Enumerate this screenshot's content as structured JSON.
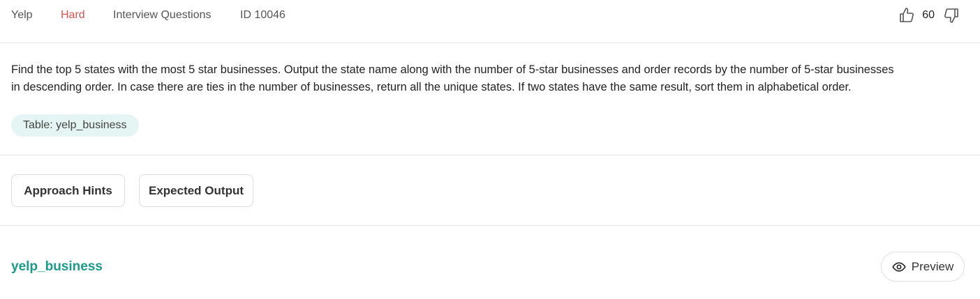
{
  "meta": {
    "company": "Yelp",
    "difficulty": "Hard",
    "category": "Interview Questions",
    "question_id": "ID 10046"
  },
  "votes": {
    "count": "60",
    "upvote_icon": "thumbs-up-icon",
    "downvote_icon": "thumbs-down-icon"
  },
  "question": {
    "line1": "Find the top 5 states with the most 5 star businesses. Output the state name along with the number of 5-star businesses and order records by the number of 5-star businesses",
    "line2": "in descending order. In case there are ties in the number of businesses, return all the unique states. If two states have the same result, sort them in alphabetical order.",
    "table_chip": "Table: yelp_business"
  },
  "actions": {
    "hints_label": "Approach Hints",
    "output_label": "Expected Output"
  },
  "table_section": {
    "table_name": "yelp_business",
    "preview_label": "Preview",
    "preview_icon": "eye-icon"
  },
  "colors": {
    "difficulty_hard": "#d9534f",
    "accent_teal": "#1a9b8c",
    "chip_bg": "#e4f5f3"
  }
}
